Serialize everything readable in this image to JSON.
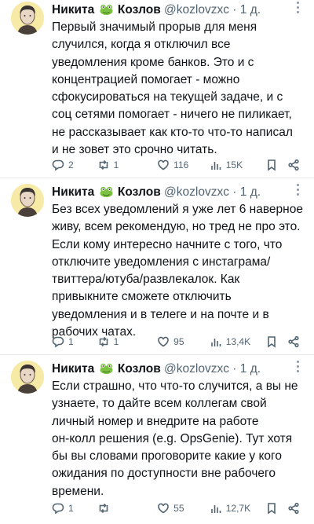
{
  "tweets": [
    {
      "author_name": "Никита",
      "author_surname": "Козлов",
      "handle": "@kozlovzxc",
      "separator": "·",
      "time": "1 д.",
      "text_lines": [
        "Первый значимый прорыв для меня",
        "случился, когда я отключил все",
        "уведомления кроме банков. Это и с",
        "концентрацией помогает - можно",
        "сфокусироваться на текущей задаче, и с",
        "соц сетями помогает - ничего не пиликает,",
        "не рассказывает как кто-то что-то написал",
        "и не зовет это срочно читать."
      ],
      "replies": "2",
      "retweets": "1",
      "likes": "116",
      "views": "15K"
    },
    {
      "author_name": "Никита",
      "author_surname": "Козлов",
      "handle": "@kozlovzxc",
      "separator": "·",
      "time": "1 д.",
      "text_lines": [
        "Без всех уведомлений я уже лет 6 наверное",
        "живу, всем рекомендую, но тред не про это.",
        "Если кому интересно начните с того, что",
        "отключите уведомления с инстаграма/",
        "твиттера/ютуба/развлекалок. Как",
        "привыкните сможете отключить",
        "уведомления и в телеге и на почте и в",
        "рабочих чатах."
      ],
      "replies": "1",
      "retweets": "1",
      "likes": "95",
      "views": "13,4K"
    },
    {
      "author_name": "Никита",
      "author_surname": "Козлов",
      "handle": "@kozlovzxc",
      "separator": "·",
      "time": "1 д.",
      "text_lines": [
        "Если страшно, что что-то случится, а вы не",
        "узнаете, то дайте всем коллегам свой",
        "личный номер и внедрите на работе",
        "он-колл решения (e.g. OpsGenie). Тут хотя",
        "бы вы словами проговорите какие у кого",
        "ожидания по доступности вне рабочего",
        "времени."
      ],
      "replies": "1",
      "retweets": "",
      "likes": "55",
      "views": "12,7K"
    }
  ],
  "icons": {
    "reply": "reply-icon",
    "retweet": "retweet-icon",
    "like": "heart-icon",
    "views": "views-icon",
    "bookmark": "bookmark-icon",
    "share": "share-icon",
    "more": "more-icon"
  },
  "colors": {
    "text": "#0f1419",
    "secondary": "#536471",
    "background": "#ffffff"
  }
}
